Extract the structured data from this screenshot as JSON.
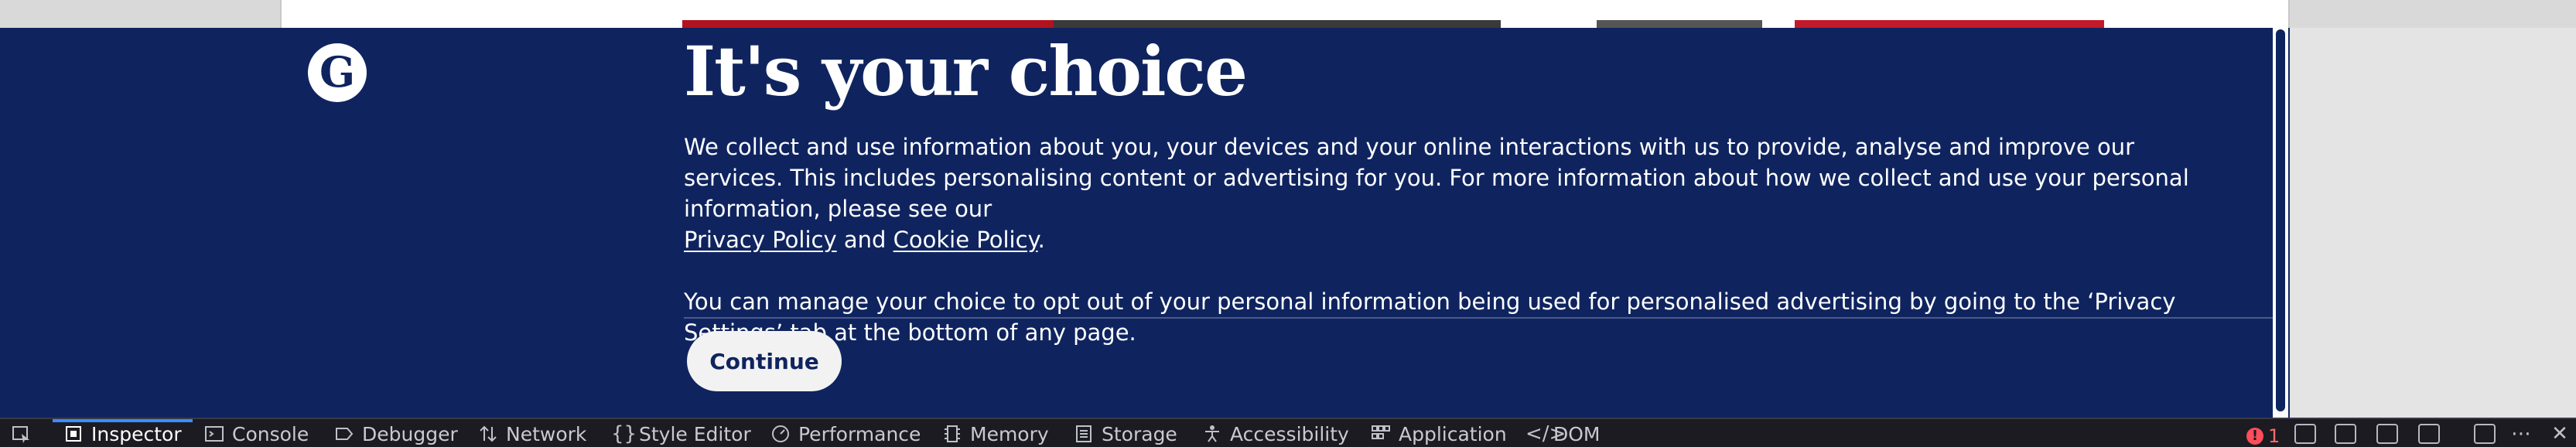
{
  "banner": {
    "logo": "G",
    "title": "It's your choice",
    "paragraph1_text": "We collect and use information about you, your devices and your online interactions with us to provide, analyse and improve our services. This includes personalising content or advertising for you. For more information about how we collect and use your personal information, please see our",
    "privacy_link": "Privacy Policy",
    "and_text": "and",
    "cookie_link": "Cookie Policy",
    "period": ".",
    "paragraph2": "You can manage your choice to opt out of your personal information being used for personalised advertising  by going to the ‘Privacy Settings’ tab at the bottom of any page.",
    "continue_label": "Continue",
    "background_color": "#0f245f"
  },
  "devtools": {
    "tabs": [
      {
        "label": "Inspector",
        "icon": "inspector-icon",
        "active": true
      },
      {
        "label": "Console",
        "icon": "console-icon"
      },
      {
        "label": "Debugger",
        "icon": "debugger-icon"
      },
      {
        "label": "Network",
        "icon": "network-icon"
      },
      {
        "label": "Style Editor",
        "icon": "style-editor-icon"
      },
      {
        "label": "Performance",
        "icon": "performance-icon"
      },
      {
        "label": "Memory",
        "icon": "memory-icon"
      },
      {
        "label": "Storage",
        "icon": "storage-icon"
      },
      {
        "label": "Accessibility",
        "icon": "accessibility-icon"
      },
      {
        "label": "Application",
        "icon": "application-icon"
      },
      {
        "label": "DOM",
        "icon": "dom-icon"
      }
    ],
    "error_count": "1",
    "accent_color": "#3b8cff"
  }
}
